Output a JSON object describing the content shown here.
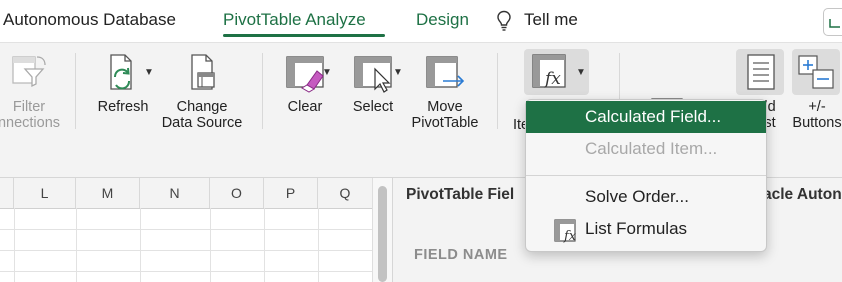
{
  "tabs": {
    "autonomous": "Autonomous Database",
    "pivot_analyze": "PivotTable Analyze",
    "design": "Design",
    "tell_me": "Tell me"
  },
  "ribbon": {
    "filter_connections_line1": "Filter",
    "filter_connections_line2": "nnections",
    "refresh": "Refresh",
    "change_source_line1": "Change",
    "change_source_line2": "Data Source",
    "clear": "Clear",
    "select": "Select",
    "move_line1": "Move",
    "move_line2": "PivotTable",
    "items_partial": "Ite",
    "field_list_partial_line1": "ld",
    "field_list_partial_line2": "st",
    "plus_minus_line1": "+/-",
    "plus_minus_line2": "Buttons"
  },
  "grid": {
    "columns": [
      "L",
      "M",
      "N",
      "O",
      "P",
      "Q"
    ]
  },
  "pane": {
    "title": "PivotTable Fiel",
    "title_right": "acle Auton",
    "field_name": "FIELD NAME"
  },
  "menu": {
    "calculated_field": "Calculated Field...",
    "calculated_item": "Calculated Item...",
    "solve_order": "Solve Order...",
    "list_formulas": "List Formulas"
  },
  "colors": {
    "accent": "#1e7145",
    "ribbon_bg": "#f3f3f3",
    "disabled_text": "#a8a8a8"
  }
}
